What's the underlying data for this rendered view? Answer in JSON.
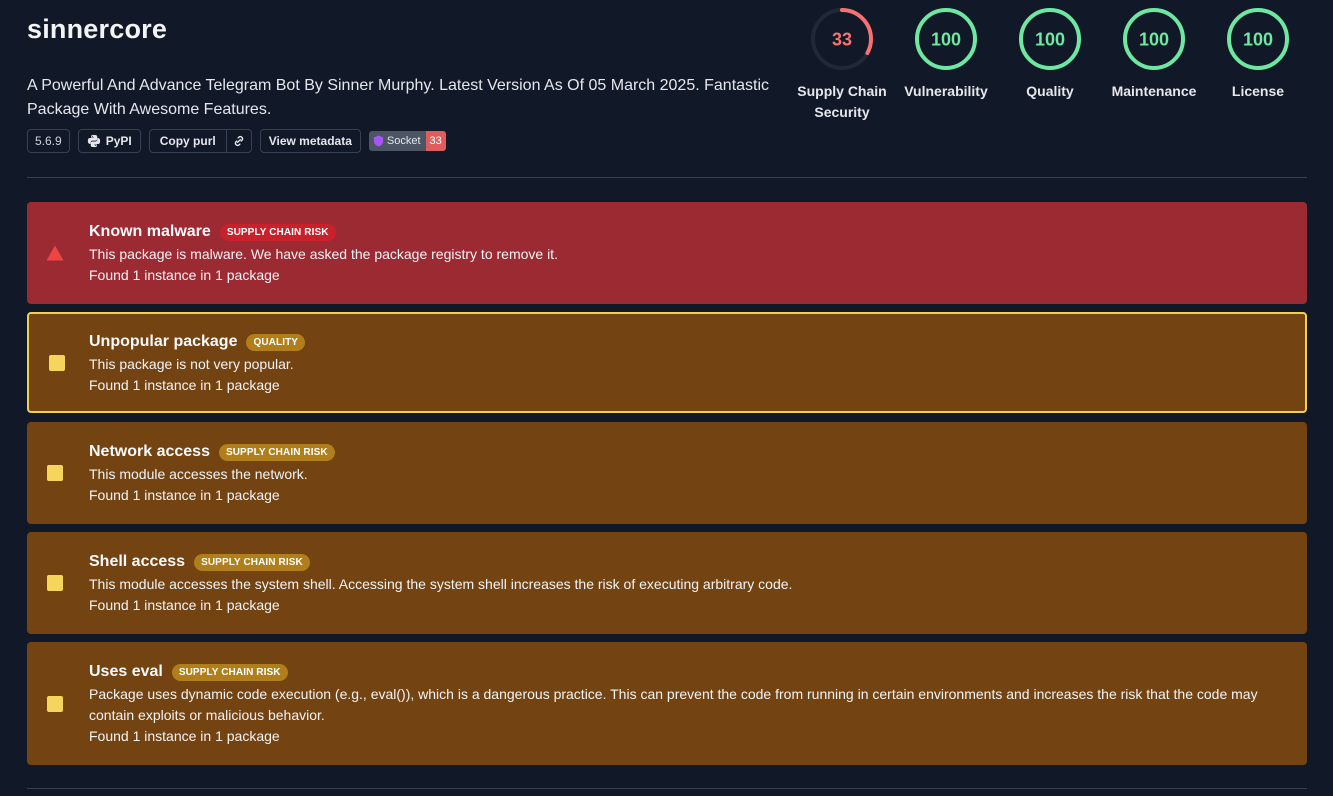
{
  "package": {
    "name": "sinnercore",
    "description": "A Powerful And Advance Telegram Bot By Sinner Murphy. Latest Version As Of 05 March 2025. Fantastic Package With Awesome Features.",
    "version": "5.6.9",
    "registry_label": "PyPI",
    "copy_purl_label": "Copy purl",
    "view_metadata_label": "View metadata",
    "socket_badge": {
      "label": "Socket",
      "score": "33"
    }
  },
  "scores": [
    {
      "value": "33",
      "label": "Supply Chain Security",
      "fraction": 0.33,
      "color": "#f87171"
    },
    {
      "value": "100",
      "label": "Vulnerability",
      "fraction": 1.0,
      "color": "#6ee7a0"
    },
    {
      "value": "100",
      "label": "Quality",
      "fraction": 1.0,
      "color": "#6ee7a0"
    },
    {
      "value": "100",
      "label": "Maintenance",
      "fraction": 1.0,
      "color": "#6ee7a0"
    },
    {
      "value": "100",
      "label": "License",
      "fraction": 1.0,
      "color": "#6ee7a0"
    }
  ],
  "alerts": [
    {
      "title": "Known malware",
      "tag": "SUPPLY CHAIN RISK",
      "description": "This package is malware. We have asked the package registry to remove it.",
      "found": "Found 1 instance in 1 package",
      "severity": "critical"
    },
    {
      "title": "Unpopular package",
      "tag": "QUALITY",
      "description": "This package is not very popular.",
      "found": "Found 1 instance in 1 package",
      "severity": "middle"
    },
    {
      "title": "Network access",
      "tag": "SUPPLY CHAIN RISK",
      "description": "This module accesses the network.",
      "found": "Found 1 instance in 1 package",
      "severity": "middle"
    },
    {
      "title": "Shell access",
      "tag": "SUPPLY CHAIN RISK",
      "description": "This module accesses the system shell. Accessing the system shell increases the risk of executing arbitrary code.",
      "found": "Found 1 instance in 1 package",
      "severity": "middle"
    },
    {
      "title": "Uses eval",
      "tag": "SUPPLY CHAIN RISK",
      "description": "Package uses dynamic code execution (e.g., eval()), which is a dangerous practice. This can prevent the code from running in certain environments and increases the risk that the code may contain exploits or malicious behavior.",
      "found": "Found 1 instance in 1 package",
      "severity": "middle"
    }
  ]
}
